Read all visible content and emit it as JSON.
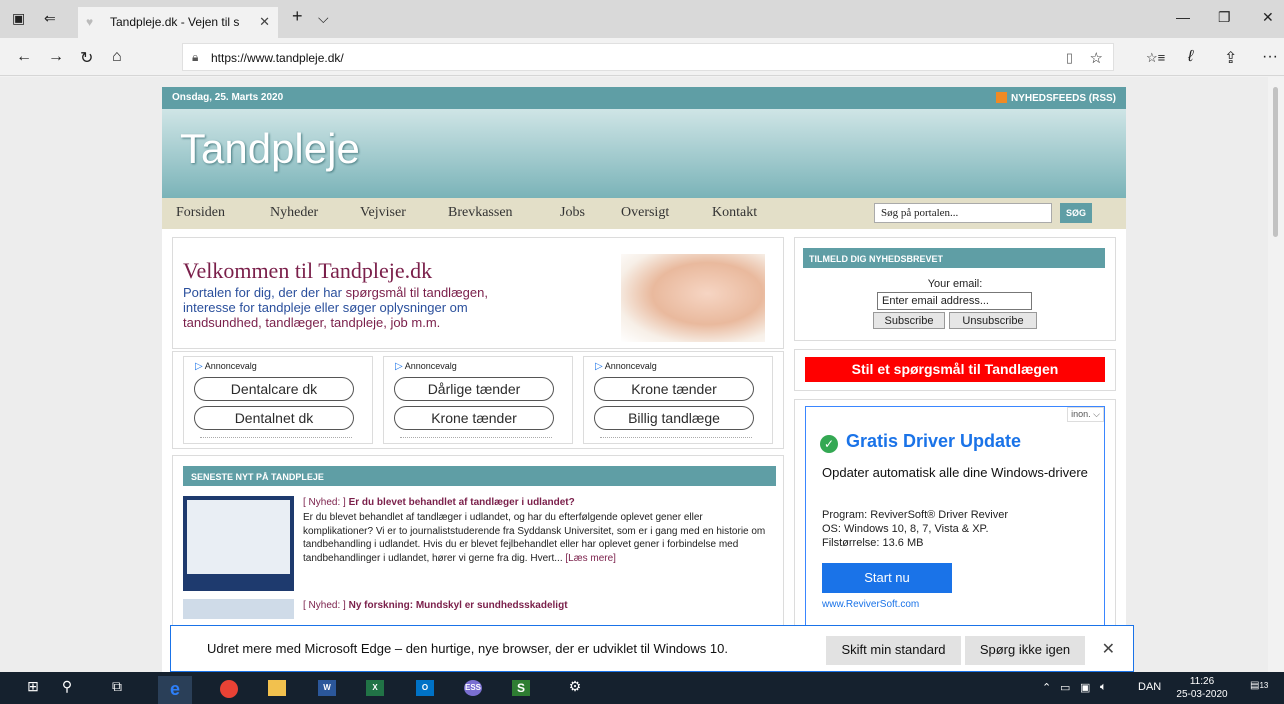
{
  "browser": {
    "tab": {
      "title": "Tandpleje.dk - Vejen til s",
      "close": "✕"
    },
    "new_tab": "+",
    "tab_list": "⌵",
    "window_controls": {
      "minimize": "—",
      "restore": "❐",
      "close": "✕"
    },
    "nav": {
      "back": "←",
      "forward": "→",
      "refresh": "↻",
      "home": "⌂"
    },
    "url": "https://www.tandpleje.dk/",
    "toolbar_icons": {
      "reading_view": "▯",
      "favorite": "☆",
      "favorites_hub": "☆≡",
      "notes": "ℓ",
      "share": "⇪",
      "more": "···"
    }
  },
  "site": {
    "date": "Onsdag, 25. Marts 2020",
    "rss_label": "NYHEDSFEEDS (RSS)",
    "logo": "Tandpleje",
    "menu": [
      "Forsiden",
      "Nyheder",
      "Vejviser",
      "Brevkassen",
      "Jobs",
      "Oversigt",
      "Kontakt"
    ],
    "search_placeholder": "Søg på portalen...",
    "search_button": "SØG",
    "welcome": {
      "title": "Velkommen til Tandpleje.dk",
      "line1_a": "Portalen for dig, der der har ",
      "line1_b": "spørgsmål til tandlægen,",
      "line2": "interesse for tandpleje eller søger oplysninger om",
      "line3": "tandsundhed, tandlæger, tandpleje, job m.m."
    },
    "ads": [
      {
        "label": "Annoncevalg",
        "links": [
          "Dentalcare dk",
          "Dentalnet dk"
        ]
      },
      {
        "label": "Annoncevalg",
        "links": [
          "Dårlige tænder",
          "Krone tænder"
        ]
      },
      {
        "label": "Annoncevalg",
        "links": [
          "Krone tænder",
          "Billig tandlæge"
        ]
      }
    ],
    "news_header": "SENESTE NYT PÅ TANDPLEJE",
    "news": [
      {
        "tag": "[ Nyhed: ]",
        "title": "Er du blevet behandlet af tandlæger i udlandet?",
        "body": "Er du blevet behandlet af tandlæger i udlandet, og har du efterfølgende oplevet gener eller komplikationer? Vi er to journaliststuderende fra Syddansk Universitet, som er i gang med en historie om tandbehandling i udlandet. Hvis du er blevet fejlbehandlet eller har oplevet gener i forbindelse med tandbehandlinger i udlandet, hører vi gerne fra dig. Hvert...",
        "more": "[Læs mere]"
      },
      {
        "tag": "[ Nyhed: ]",
        "title": "Ny forskning: Mundskyl er sundhedsskadeligt"
      }
    ],
    "newsletter": {
      "header": "TILMELD DIG NYHEDSBREVET",
      "email_label": "Your email:",
      "email_placeholder": "Enter email address...",
      "subscribe": "Subscribe",
      "unsubscribe": "Unsubscribe"
    },
    "ask_button": "Stil et spørgsmål til Tandlægen",
    "google_ad": {
      "adchoices": "inon. ⌵",
      "title": "Gratis Driver Update",
      "subtitle": "Opdater automatisk alle dine Windows-drivere",
      "body1": "Program: ReviverSoft® Driver Reviver",
      "body2": "OS: Windows 10, 8, 7, Vista & XP.",
      "body3": "Filstørrelse: 13.6 MB",
      "cta": "Start nu",
      "url": "www.ReviverSoft.com"
    }
  },
  "notification": {
    "message": "Udret mere med Microsoft Edge – den hurtige, nye browser, der er udviklet til Windows 10.",
    "primary": "Skift min standard",
    "secondary": "Spørg ikke igen",
    "close": "✕"
  },
  "taskbar": {
    "language": "DAN",
    "time": "11:26",
    "date": "25-03-2020",
    "notifications": "13"
  }
}
